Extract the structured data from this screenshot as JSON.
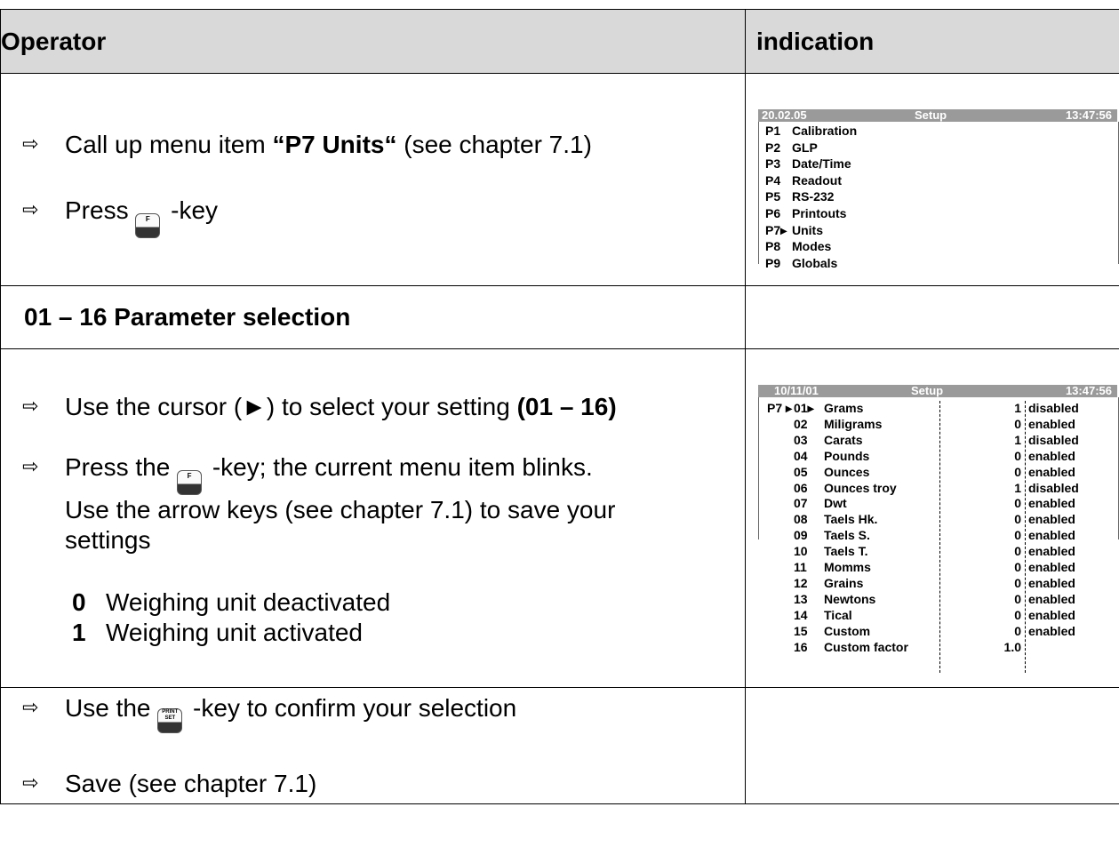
{
  "header": {
    "operator": "Operator",
    "indication": "indication"
  },
  "block1": {
    "step1_pre": "Call up menu item ",
    "step1_bold": "“P7 Units“",
    "step1_post": " (see chapter 7.1)",
    "step2_pre": "Press ",
    "step2_post": " -key",
    "key_f_label": "F"
  },
  "display1": {
    "date": "20.02.05",
    "title": "Setup",
    "time": "13:47:56",
    "items": [
      {
        "code": "P1",
        "label": "Calibration"
      },
      {
        "code": "P2",
        "label": "GLP"
      },
      {
        "code": "P3",
        "label": "Date/Time"
      },
      {
        "code": "P4",
        "label": "Readout"
      },
      {
        "code": "P5",
        "label": "RS-232"
      },
      {
        "code": "P6",
        "label": "Printouts"
      },
      {
        "code": "P7▸",
        "label": "Units"
      },
      {
        "code": "P8",
        "label": "Modes"
      },
      {
        "code": "P9",
        "label": "Globals"
      }
    ]
  },
  "section": {
    "title": "01 – 16 Parameter selection"
  },
  "block2": {
    "step1_pre": "Use the cursor (►) to select your setting ",
    "step1_bold": "(01 – 16)",
    "step2_pre": "Press the ",
    "step2_post": " -key; the current menu item blinks.",
    "step2_line2": "Use the arrow keys (see chapter 7.1) to save your",
    "step2_line3": "settings",
    "options": [
      {
        "value": "0",
        "label": "Weighing unit deactivated"
      },
      {
        "value": "1",
        "label": "Weighing unit activated"
      }
    ]
  },
  "display2": {
    "date": "10/11/01",
    "title": "Setup",
    "time": "13:47:56",
    "prefix": "P7 ▸",
    "rows": [
      {
        "num": "01▸",
        "name": "Grams",
        "val": "1",
        "state": "disabled"
      },
      {
        "num": "02",
        "name": "Miligrams",
        "val": "0",
        "state": "enabled"
      },
      {
        "num": "03",
        "name": "Carats",
        "val": "1",
        "state": "disabled"
      },
      {
        "num": "04",
        "name": "Pounds",
        "val": "0",
        "state": "enabled"
      },
      {
        "num": "05",
        "name": "Ounces",
        "val": "0",
        "state": "enabled"
      },
      {
        "num": "06",
        "name": "Ounces troy",
        "val": "1",
        "state": "disabled"
      },
      {
        "num": "07",
        "name": "Dwt",
        "val": "0",
        "state": "enabled"
      },
      {
        "num": "08",
        "name": "Taels Hk.",
        "val": "0",
        "state": "enabled"
      },
      {
        "num": "09",
        "name": "Taels S.",
        "val": "0",
        "state": "enabled"
      },
      {
        "num": "10",
        "name": "Taels T.",
        "val": "0",
        "state": "enabled"
      },
      {
        "num": "11",
        "name": "Momms",
        "val": "0",
        "state": "enabled"
      },
      {
        "num": "12",
        "name": "Grains",
        "val": "0",
        "state": "enabled"
      },
      {
        "num": "13",
        "name": "Newtons",
        "val": "0",
        "state": "enabled"
      },
      {
        "num": "14",
        "name": "Tical",
        "val": "0",
        "state": "enabled"
      },
      {
        "num": "15",
        "name": "Custom",
        "val": "0",
        "state": "enabled"
      },
      {
        "num": "16",
        "name": "Custom factor",
        "val": "1.0",
        "state": ""
      }
    ]
  },
  "block3": {
    "step1_pre": "Use the ",
    "step1_post": " -key to confirm your selection",
    "step2": "Save (see chapter 7.1)",
    "key_print_label": "PRINT SET"
  }
}
